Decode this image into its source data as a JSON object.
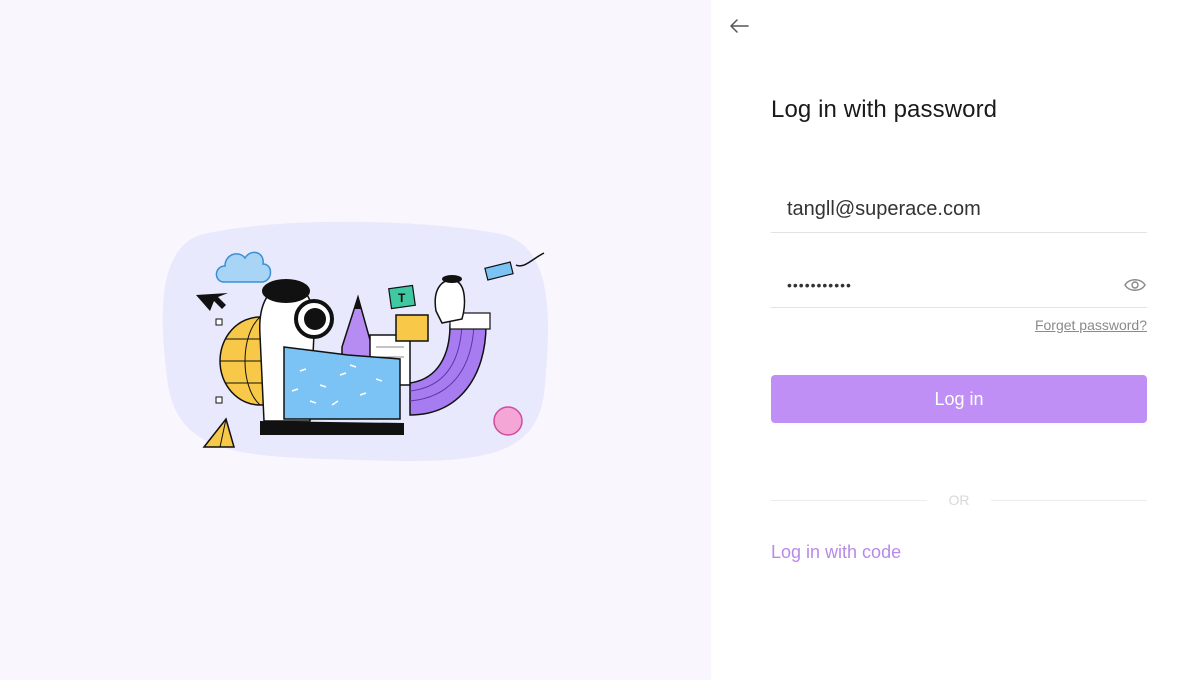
{
  "header": {
    "back_icon": "arrow-left-icon"
  },
  "login": {
    "title": "Log in with password",
    "email": {
      "value": "tangll@superace.com",
      "placeholder": ""
    },
    "password": {
      "value": "superace123",
      "toggle_icon": "eye-icon"
    },
    "forget_password": "Forget password?",
    "submit_label": "Log in",
    "divider_text": "OR",
    "alt_login": "Log in with code"
  },
  "colors": {
    "accent": "#bf8ff5",
    "link": "#b88ae8",
    "left_panel_bg": "#f9f6fe",
    "illustration_blob": "#e8e9fc"
  }
}
